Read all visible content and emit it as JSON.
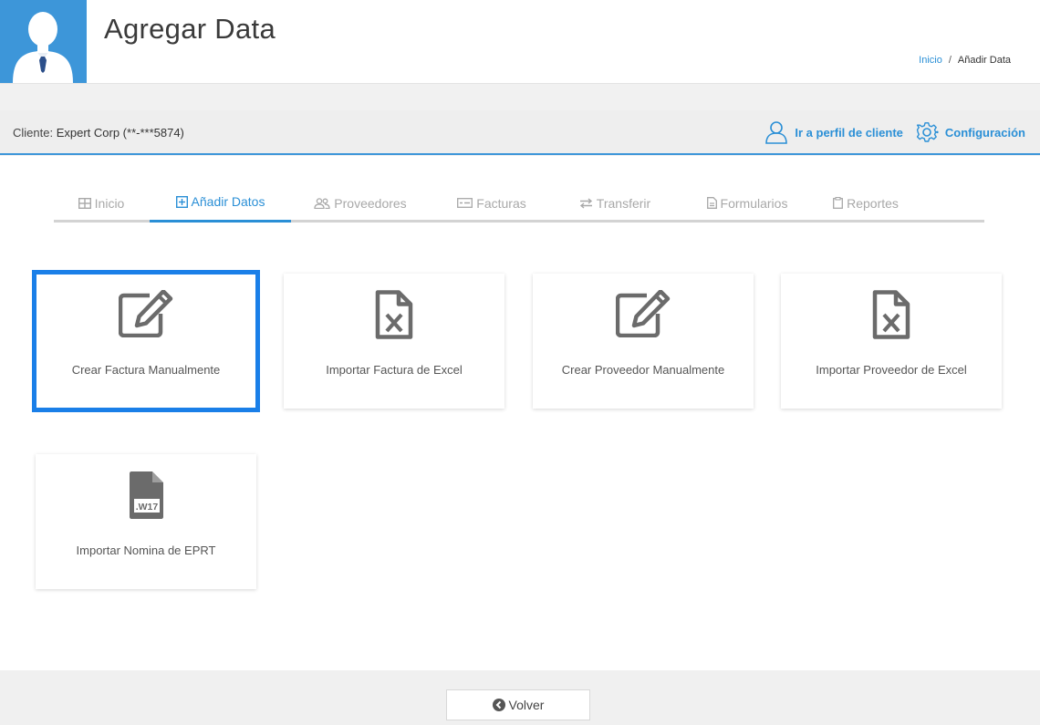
{
  "header": {
    "title": "Agregar Data",
    "breadcrumb": {
      "home": "Inicio",
      "separator": "/",
      "current": "Añadir Data"
    }
  },
  "client_bar": {
    "label": "Cliente:",
    "name": "Expert Corp (**-***5874)",
    "profile_link": "Ir a perfil de cliente",
    "settings_link": "Configuración"
  },
  "tabs": [
    {
      "label": "Inicio",
      "icon": "grid-icon"
    },
    {
      "label": "Añadir Datos",
      "icon": "plus-square-icon",
      "active": true
    },
    {
      "label": "Proveedores",
      "icon": "users-icon"
    },
    {
      "label": "Facturas",
      "icon": "invoice-icon"
    },
    {
      "label": "Transferir",
      "icon": "transfer-arrows-icon"
    },
    {
      "label": "Formularios",
      "icon": "document-icon"
    },
    {
      "label": "Reportes",
      "icon": "clipboard-icon"
    }
  ],
  "cards": [
    {
      "label": "Crear Factura Manualmente",
      "icon": "edit-icon",
      "selected": true
    },
    {
      "label": "Importar Factura de Excel",
      "icon": "excel-file-icon"
    },
    {
      "label": "Crear Proveedor Manualmente",
      "icon": "edit-icon"
    },
    {
      "label": "Importar Proveedor de Excel",
      "icon": "excel-file-icon"
    },
    {
      "label": "Importar Nomina de EPRT",
      "icon": "w17-file-icon",
      "icon_text": ".W17"
    }
  ],
  "footer": {
    "back_label": "Volver",
    "back_icon": "arrow-circle-left-icon"
  },
  "colors": {
    "accent": "#2a8fd6",
    "avatar_bg": "#3d96d9",
    "selection": "#1a7fe8",
    "icon_gray": "#6b6b6b"
  }
}
